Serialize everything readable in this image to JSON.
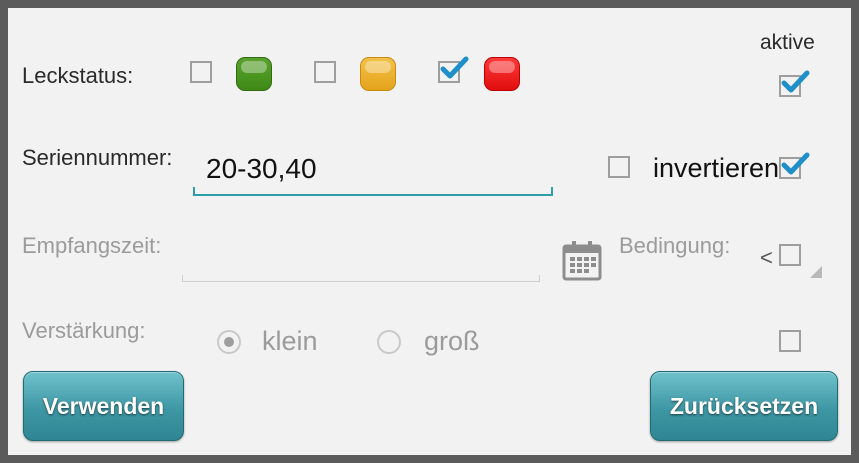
{
  "header": {
    "active_label": "aktive"
  },
  "leak_status": {
    "label": "Leckstatus:",
    "options": [
      {
        "name": "green",
        "checked": false,
        "color": "#4a9420"
      },
      {
        "name": "yellow",
        "checked": false,
        "color": "#e8ad22"
      },
      {
        "name": "red",
        "checked": true,
        "color": "#f01a1a"
      }
    ],
    "active_checked": true
  },
  "serial": {
    "label": "Seriennummer:",
    "value": "20-30,40",
    "invert_label": "invertieren",
    "invert_checked": false,
    "active_checked": true
  },
  "receive_time": {
    "label": "Empfangszeit:",
    "value": "",
    "condition_label": "Bedingung:",
    "condition_value": "<",
    "active_checked": false
  },
  "gain": {
    "label": "Verstärkung:",
    "options": [
      {
        "label": "klein",
        "selected": true
      },
      {
        "label": "groß",
        "selected": false
      }
    ],
    "active_checked": false
  },
  "buttons": {
    "apply_label": "Verwenden",
    "reset_label": "Zurücksetzen"
  },
  "colors": {
    "accent": "#2c9fa8",
    "check": "#1f8fc9",
    "button": "#3e97a4"
  }
}
